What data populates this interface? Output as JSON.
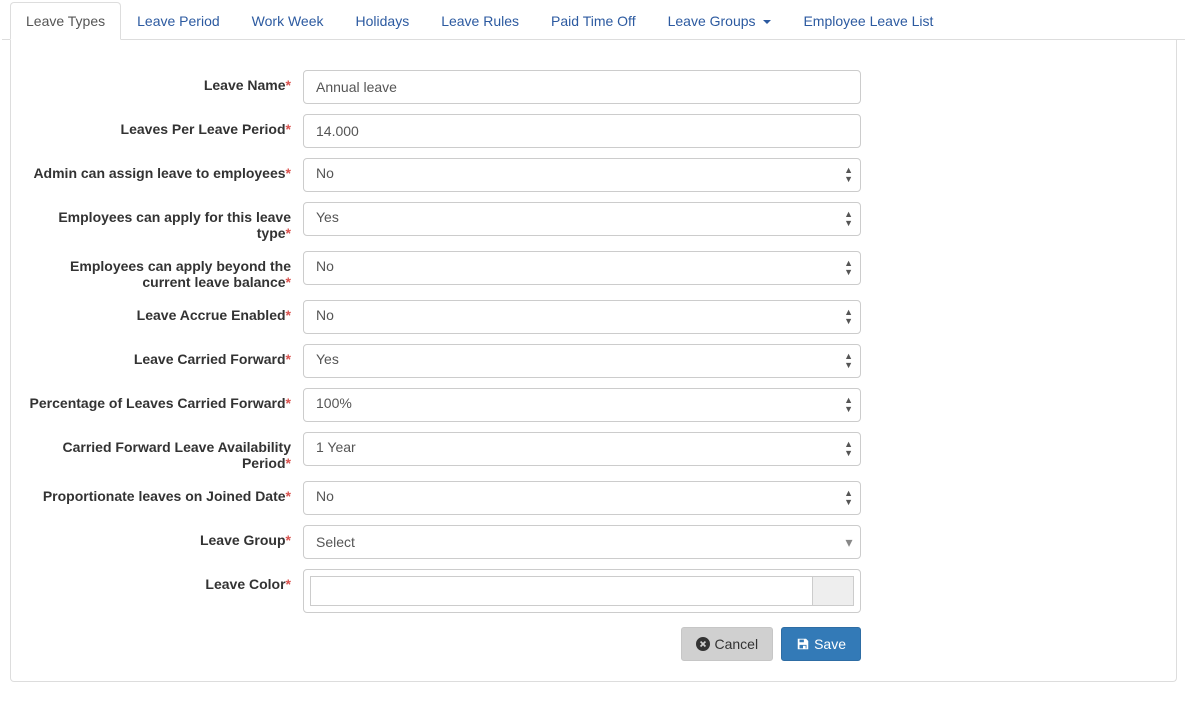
{
  "tabs": [
    {
      "label": "Leave Types",
      "active": true
    },
    {
      "label": "Leave Period"
    },
    {
      "label": "Work Week"
    },
    {
      "label": "Holidays"
    },
    {
      "label": "Leave Rules"
    },
    {
      "label": "Paid Time Off"
    },
    {
      "label": "Leave Groups",
      "dropdown": true
    },
    {
      "label": "Employee Leave List"
    }
  ],
  "form": {
    "leave_name": {
      "label": "Leave Name",
      "value": "Annual leave"
    },
    "leaves_per_period": {
      "label": "Leaves Per Leave Period",
      "value": "14.000"
    },
    "admin_assign": {
      "label": "Admin can assign leave to employees",
      "value": "No"
    },
    "employees_apply": {
      "label": "Employees can apply for this leave type",
      "value": "Yes"
    },
    "apply_beyond": {
      "label": "Employees can apply beyond the current leave balance",
      "value": "No"
    },
    "accrue_enabled": {
      "label": "Leave Accrue Enabled",
      "value": "No"
    },
    "carried_forward": {
      "label": "Leave Carried Forward",
      "value": "Yes"
    },
    "pct_carried": {
      "label": "Percentage of Leaves Carried Forward",
      "value": "100%"
    },
    "cf_availability": {
      "label": "Carried Forward Leave Availability Period",
      "value": "1 Year"
    },
    "proportionate": {
      "label": "Proportionate leaves on Joined Date",
      "value": "No"
    },
    "leave_group": {
      "label": "Leave Group",
      "value": "Select"
    },
    "leave_color": {
      "label": "Leave Color",
      "value": ""
    }
  },
  "buttons": {
    "cancel": "Cancel",
    "save": "Save"
  }
}
